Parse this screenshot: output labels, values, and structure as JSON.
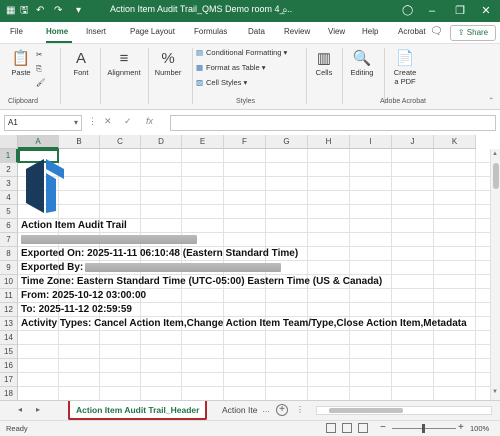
{
  "titlebar": {
    "doc_title": "Action Item Audit Trail_QMS Demo room 4_...",
    "icons": [
      "excel-logo-icon",
      "save-icon",
      "undo-icon",
      "redo-icon",
      "customize-icon",
      "search-icon",
      "user-icon",
      "minimize-icon",
      "restore-icon",
      "close-icon"
    ]
  },
  "ribbon_tabs": [
    "File",
    "Home",
    "Insert",
    "Page Layout",
    "Formulas",
    "Data",
    "Review",
    "View",
    "Help",
    "Acrobat"
  ],
  "share_label": "Share",
  "ribbon": {
    "paste": "Paste",
    "clipboard": "Clipboard",
    "font": "Font",
    "alignment": "Alignment",
    "number": "Number",
    "conditional_formatting": "Conditional Formatting",
    "format_as_table": "Format as Table",
    "cell_styles": "Cell Styles",
    "styles": "Styles",
    "cells": "Cells",
    "editing": "Editing",
    "create_pdf_line1": "Create",
    "create_pdf_line2": "a PDF",
    "adobe_acrobat": "Adobe Acrobat"
  },
  "formula_bar": {
    "name_box": "A1",
    "cancel": "✕",
    "enter": "✓",
    "fx": "fx",
    "formula": ""
  },
  "columns": [
    "A",
    "B",
    "C",
    "D",
    "E",
    "F",
    "G",
    "H",
    "I",
    "J",
    "K"
  ],
  "rows": [
    "1",
    "2",
    "3",
    "4",
    "5",
    "6",
    "7",
    "8",
    "9",
    "10",
    "11",
    "12",
    "13",
    "14",
    "15",
    "16",
    "17",
    "18"
  ],
  "cells": {
    "r6": "Action Item Audit Trail",
    "r8": "Exported On: 2025-11-11 06:10:48 (Eastern Standard Time)",
    "r9": "Exported By:",
    "r10": "Time Zone: Eastern Standard Time (UTC-05:00) Eastern Time (US & Canada)",
    "r11": "From: 2025-10-12 03:00:00",
    "r12": "To: 2025-11-12 02:59:59",
    "r13": "Activity Types: Cancel Action Item,Change Action Item Team/Type,Close Action Item,Metadata"
  },
  "sheet_tabs": {
    "active": "Action Item Audit Trail_Header",
    "next": "Action Ite"
  },
  "status": {
    "ready": "Ready",
    "zoom": "100%",
    "zoom_minus": "−",
    "zoom_plus": "+"
  },
  "colors": {
    "excel_green": "#217346",
    "active_tab_border": "#b2272d",
    "logo_blue": "#2e7fd0",
    "logo_dark": "#1a3a5c"
  }
}
